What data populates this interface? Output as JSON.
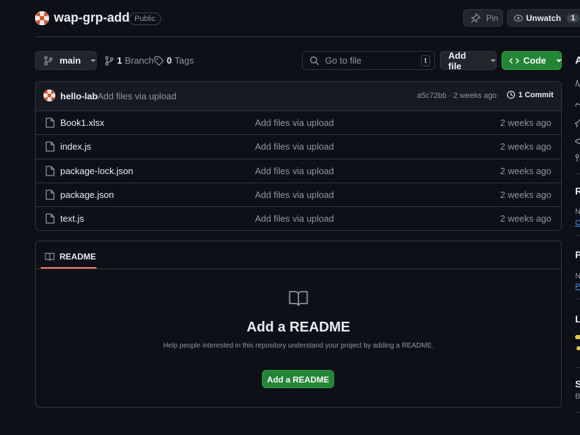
{
  "repo": {
    "name": "wap-grp-add",
    "visibility": "Public",
    "pin_label": "Pin",
    "unwatch_label": "Unwatch",
    "watch_count": "1"
  },
  "toolbar": {
    "branch": "main",
    "branch_count": "1",
    "branch_word": "Branch",
    "tag_count": "0",
    "tag_word": "Tags",
    "search_placeholder": "Go to file",
    "search_shortcut": "t",
    "add_file_label": "Add file",
    "code_label": "Code"
  },
  "commit": {
    "author": "hello-lab",
    "message": "Add files via upload",
    "hash_time": "a5c72bb · 2 weeks ago",
    "commits_label": "1 Commit"
  },
  "files": [
    {
      "name": "Book1.xlsx",
      "message": "Add files via upload",
      "date": "2 weeks ago"
    },
    {
      "name": "index.js",
      "message": "Add files via upload",
      "date": "2 weeks ago"
    },
    {
      "name": "package-lock.json",
      "message": "Add files via upload",
      "date": "2 weeks ago"
    },
    {
      "name": "package.json",
      "message": "Add files via upload",
      "date": "2 weeks ago"
    },
    {
      "name": "text.js",
      "message": "Add files via upload",
      "date": "2 weeks ago"
    }
  ],
  "readme": {
    "tab_label": "README",
    "heading": "Add a README",
    "description": "Help people interested in this repository understand your project by adding a README.",
    "button_label": "Add a README"
  },
  "sidebar_partial": {
    "about_initial": "A",
    "releases_initial": "R",
    "packages_initial": "P",
    "languages_initial": "L",
    "suggested_initial": "S",
    "r_line1": "N",
    "r_line2": "C",
    "p_line1": "N",
    "p_line2": "P",
    "s_line1": "B",
    "m_initial": "M"
  },
  "colors": {
    "background": "#0d1117",
    "border": "#30363d",
    "green_button": "#238636",
    "link": "#4493f8",
    "readme_underline": "#f78166"
  }
}
